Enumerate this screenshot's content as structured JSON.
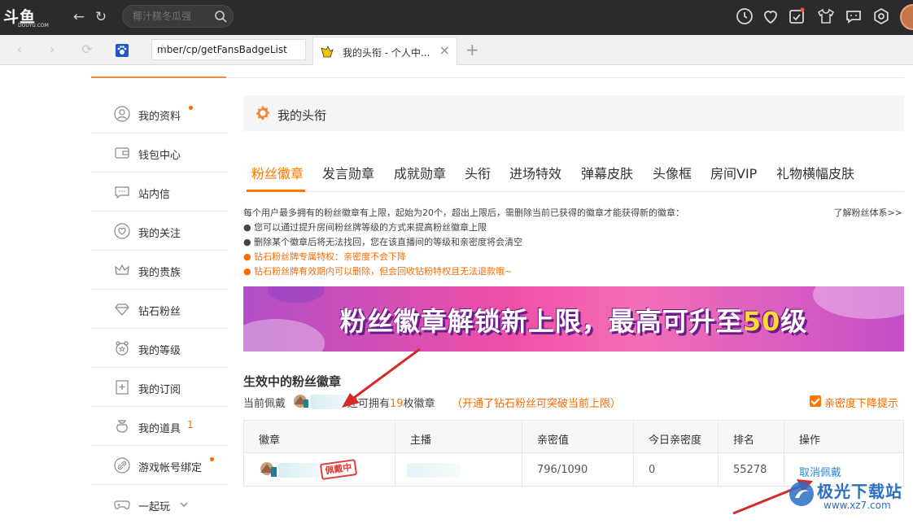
{
  "app": {
    "logo_text": "斗鱼",
    "logo_sub": "DOUYU.COM",
    "search_placeholder": "椰汁糕冬瓜强"
  },
  "browser": {
    "url_text": "mber/cp/getFansBadgeList",
    "active_tab_title": "我的头衔 - 个人中..."
  },
  "sidebar": {
    "items": [
      {
        "label": "我的资料",
        "dot": true,
        "count": ""
      },
      {
        "label": "钱包中心",
        "dot": false,
        "count": ""
      },
      {
        "label": "站内信",
        "dot": false,
        "count": ""
      },
      {
        "label": "我的关注",
        "dot": false,
        "count": ""
      },
      {
        "label": "我的贵族",
        "dot": false,
        "count": ""
      },
      {
        "label": "钻石粉丝",
        "dot": false,
        "count": ""
      },
      {
        "label": "我的等级",
        "dot": false,
        "count": ""
      },
      {
        "label": "我的订阅",
        "dot": false,
        "count": ""
      },
      {
        "label": "我的道具",
        "dot": false,
        "count": "1"
      },
      {
        "label": "游戏帐号绑定",
        "dot": true,
        "count": ""
      },
      {
        "label": "一起玩",
        "dot": false,
        "count": ""
      }
    ]
  },
  "page": {
    "title": "我的头衔",
    "tabs": [
      "粉丝徽章",
      "发言勋章",
      "成就勋章",
      "头衔",
      "进场特效",
      "弹幕皮肤",
      "头像框",
      "房间VIP",
      "礼物横幅皮肤"
    ],
    "active_tab": 0
  },
  "info": {
    "line1": "每个用户最多拥有的粉丝徽章有上限，起始为20个，超出上限后，需删除当前已获得的徽章才能获得新的徽章：",
    "more_link": "了解粉丝体系>>",
    "bullets": [
      {
        "text": "● 您可以通过提升房间粉丝牌等级的方式来提高粉丝徽章上限",
        "warn": false
      },
      {
        "text": "● 删除某个徽章后将无法找回，您在该直播间的等级和亲密度将会清空",
        "warn": false
      },
      {
        "text": "● 钻石粉丝牌专属特权：亲密度不会下降",
        "warn": true
      },
      {
        "text": "● 钻石粉丝牌有效期内可以删除，但会回收钻粉特权且无法退款哦~",
        "warn": true
      }
    ]
  },
  "banner": {
    "text_main": "粉丝徽章解锁新上限，最高可升至",
    "text_num": "50",
    "text_tail": "级"
  },
  "section": {
    "title": "生效中的粉丝徽章",
    "current_label": "当前佩戴",
    "remain_prefix": "还可拥有",
    "remain_num": "19",
    "remain_suffix": "枚徽章",
    "diamond_note": "（开通了钻石粉丝可突破当前上限）",
    "checkbox_label": "亲密度下降提示"
  },
  "table": {
    "headers": [
      "徽章",
      "主播",
      "亲密值",
      "今日亲密度",
      "排名",
      "操作"
    ],
    "rows": [
      {
        "badge_stamp": "佩戴中",
        "intimacy": "796/1090",
        "today": "0",
        "rank": "55278",
        "action": "取消佩戴"
      }
    ]
  },
  "watermark": {
    "title": "极光下载站",
    "url": "www.xz7.com"
  },
  "colors": {
    "accent": "#ff7700",
    "warn": "#ff6a00",
    "link": "#2e8bd9",
    "topbar": "#2b2b2b"
  }
}
